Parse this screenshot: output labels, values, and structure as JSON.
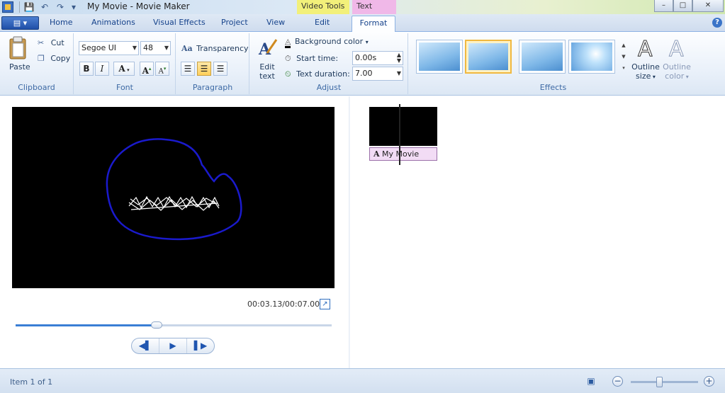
{
  "window": {
    "title": "My Movie - Movie Maker",
    "context_tabs": {
      "video_tools": "Video Tools",
      "text_tools": "Text Tools"
    },
    "controls": {
      "minimize": "–",
      "maximize": "□",
      "close": "✕"
    }
  },
  "quick_access": {
    "save": "💾",
    "undo": "↶",
    "redo": "↷",
    "customize": "▾"
  },
  "tabs": {
    "app_menu": "▤ ▾",
    "items": [
      "Home",
      "Animations",
      "Visual Effects",
      "Project",
      "View",
      "Edit",
      "Format"
    ],
    "active": "Format",
    "help": "?"
  },
  "ribbon": {
    "clipboard": {
      "label": "Clipboard",
      "paste": "Paste",
      "cut": "Cut",
      "copy": "Copy"
    },
    "font": {
      "label": "Font",
      "family": "Segoe UI",
      "size": "48",
      "bold": "B",
      "italic": "I",
      "color": "A",
      "grow": "A",
      "shrink": "A"
    },
    "paragraph": {
      "label": "Paragraph",
      "transparency": "Transparency"
    },
    "adjust": {
      "label": "Adjust",
      "edit_text": "Edit text",
      "background_color": "Background color",
      "start_time_label": "Start time:",
      "start_time_value": "0.00s",
      "text_duration_label": "Text duration:",
      "text_duration_value": "7.00"
    },
    "effects": {
      "label": "Effects",
      "outline_size": "Outline size",
      "outline_color": "Outline color",
      "selected_index": 1
    }
  },
  "preview": {
    "timecode": "00:03.13/00:07.00",
    "progress": 0.447,
    "caption_scribble_color": "#1a1acc"
  },
  "storyboard": {
    "clip_caption": "My Movie",
    "caption_icon": "A"
  },
  "status": {
    "item_text": "Item 1 of 1",
    "zoom_level": 0.42
  },
  "colors": {
    "accent": "#3a7fd5",
    "selected_effect": "#f0b840",
    "caption_bg": "#f2dcf5"
  }
}
